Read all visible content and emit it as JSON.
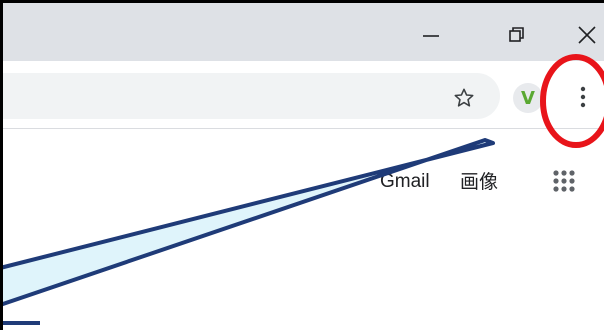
{
  "window_controls": {
    "minimize_icon": "minimize-icon",
    "maximize_icon": "restore-icon",
    "close_icon": "close-icon"
  },
  "toolbar": {
    "bookmark_icon": "star-icon",
    "extension_letter": "V",
    "menu_icon": "vertical-dots-icon"
  },
  "header_links": {
    "gmail": "Gmail",
    "images": "画像",
    "apps_icon": "apps-grid-icon"
  },
  "annotation": {
    "circle_color": "#e8141a",
    "callout_fill": "#dff4fb",
    "callout_stroke": "#1f3b78"
  }
}
